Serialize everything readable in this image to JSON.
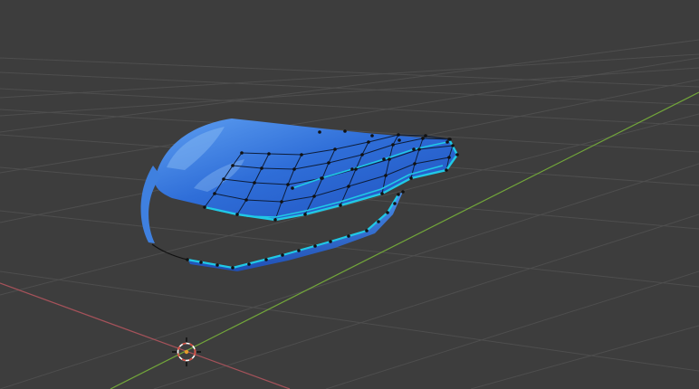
{
  "app": "3D Viewport",
  "colors": {
    "background": "#3d3d3d",
    "grid_line": "#4e4e4e",
    "x_axis": "#a5525a",
    "y_axis": "#72a63a",
    "mesh_fill": "#2f69d8",
    "mesh_highlight": "#6aa7ef",
    "selected_edge": "#20c9e6",
    "vertex": "#111111",
    "cursor_outer": "#ffffff",
    "cursor_dash": "#d94a3c",
    "cursor_center": "#e39b2c"
  },
  "icons": {
    "cursor": "3d-cursor-icon"
  }
}
